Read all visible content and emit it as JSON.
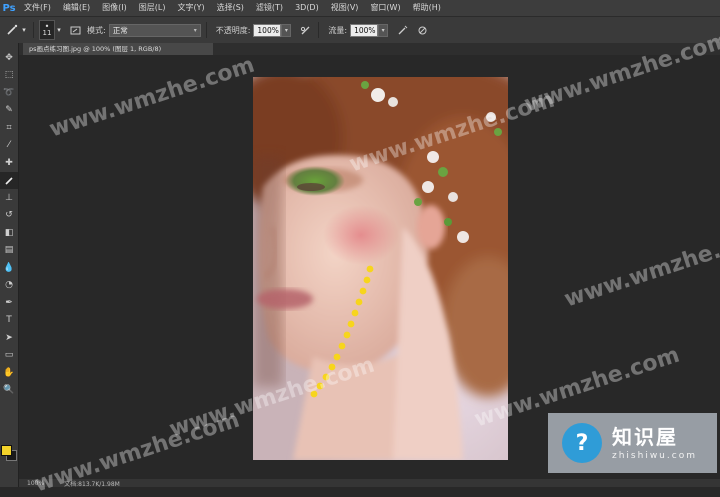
{
  "app": {
    "logo": "Ps"
  },
  "menu": [
    "文件(F)",
    "编辑(E)",
    "图像(I)",
    "图层(L)",
    "文字(Y)",
    "选择(S)",
    "滤镜(T)",
    "3D(D)",
    "视图(V)",
    "窗口(W)",
    "帮助(H)"
  ],
  "options": {
    "brush_size": "11",
    "mode_label": "模式:",
    "mode_value": "正常",
    "opacity_label": "不透明度:",
    "opacity_value": "100%",
    "flow_label": "流量:",
    "flow_value": "100%"
  },
  "document": {
    "tab_title": "ps画点练习图.jpg @ 100% (图层 1, RGB/8)"
  },
  "status": {
    "zoom": "100%",
    "doc_info": "文档:813.7K/1.98M"
  },
  "colors": {
    "foreground": "#f3d32a",
    "background": "#1a1a1a",
    "dots": "#f7d51c"
  },
  "watermark": "www.wmzhe.com",
  "badge": {
    "cn": "知识屋",
    "en": "zhishiwu.com"
  }
}
